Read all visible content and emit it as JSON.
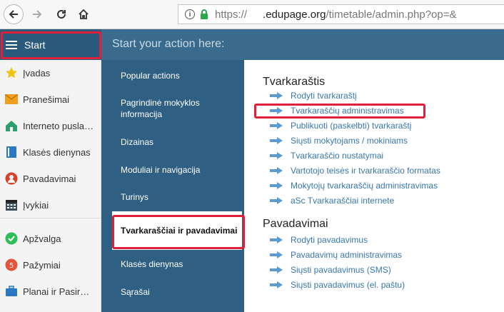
{
  "browser": {
    "info_icon": "info-icon",
    "url_scheme": "https://",
    "url_host": ".edupage.org",
    "url_path": "/timetable/admin.php?op=&"
  },
  "header": {
    "start_label": "Start",
    "prompt": "Start your action here:"
  },
  "sidebar": {
    "items": [
      {
        "label": "Įvadas",
        "icon": "star-icon"
      },
      {
        "label": "Pranešimai",
        "icon": "envelope-icon"
      },
      {
        "label": "Interneto puslapis",
        "icon": "house-icon"
      },
      {
        "label": "Klasės dienynas",
        "icon": "book-icon"
      },
      {
        "label": "Pavadavimai",
        "icon": "person-icon"
      },
      {
        "label": "Įvykiai",
        "icon": "calendar-icon"
      },
      {
        "label": "Apžvalga",
        "icon": "check-circle-icon"
      },
      {
        "label": "Pažymiai",
        "icon": "grade-icon"
      },
      {
        "label": "Planai ir Pasiruošimas",
        "icon": "briefcase-icon"
      }
    ]
  },
  "categories": {
    "items": [
      {
        "label": "Popular actions"
      },
      {
        "label": "Pagrindinė mokyklos informacija"
      },
      {
        "label": "Dizainas"
      },
      {
        "label": "Moduliai ir navigacija"
      },
      {
        "label": "Turinys"
      },
      {
        "label": "Tvarkaraščiai ir pavadavimai"
      },
      {
        "label": "Klasės dienynas"
      },
      {
        "label": "Sąrašai"
      }
    ]
  },
  "content": {
    "sections": [
      {
        "title": "Tvarkaraštis",
        "links": [
          "Rodyti tvarkaraštį",
          "Tvarkaraščių administravimas",
          "Publikuoti (paskelbti) tvarkaraštį",
          "Siųsti mokytojams / mokiniams",
          "Tvarkaraščio nustatymai",
          "Vartotojo teisės ir tvarkaraščio formatas",
          "Mokytojų tvarkaraščių administravimas",
          "aSc Tvarkaraščiai internete"
        ]
      },
      {
        "title": "Pavadavimai",
        "links": [
          "Rodyti pavadavimus",
          "Pavadavimų administravimas",
          "Siųsti pavadavimus (SMS)",
          "Siųsti pavadavimus (el. paštu)"
        ]
      }
    ]
  },
  "colors": {
    "header_bg": "#3a6b8d",
    "category_bg": "#2f5f82",
    "link": "#3877ae",
    "highlight": "#e0203a"
  }
}
